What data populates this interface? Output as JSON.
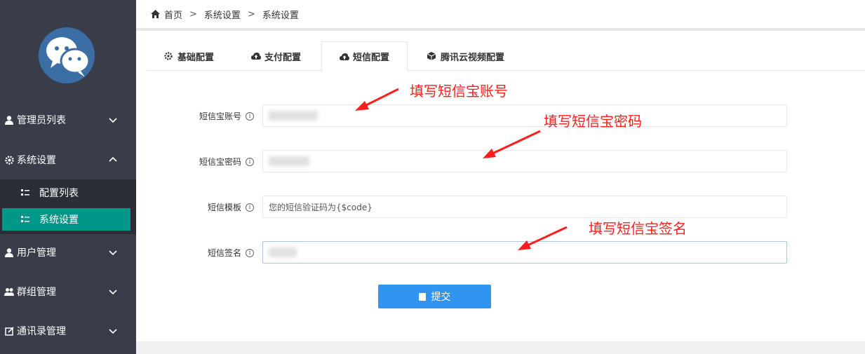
{
  "breadcrumb": {
    "items": [
      "首页",
      "系统设置",
      "系统设置"
    ],
    "separator": ">"
  },
  "sidebar": {
    "menu": [
      {
        "label": "管理员列表",
        "icon": "user-icon"
      },
      {
        "label": "系统设置",
        "icon": "gear-icon"
      },
      {
        "label": "用户管理",
        "icon": "user-icon"
      },
      {
        "label": "群组管理",
        "icon": "group-icon"
      },
      {
        "label": "通讯录管理",
        "icon": "edit-icon"
      }
    ],
    "submenu": [
      {
        "label": "配置列表",
        "icon": "list-icon"
      },
      {
        "label": "系统设置",
        "icon": "list-icon"
      }
    ],
    "active_color": "#009688"
  },
  "tabs": [
    {
      "label": "基础配置",
      "icon": "gear-icon"
    },
    {
      "label": "支付配置",
      "icon": "cloud-upload-icon"
    },
    {
      "label": "短信配置",
      "icon": "cloud-upload-icon"
    },
    {
      "label": "腾讯云视频配置",
      "icon": "cube-icon"
    }
  ],
  "form": {
    "account_label": "短信宝账号",
    "password_label": "短信宝密码",
    "template_label": "短信模板",
    "template_value": "您的短信验证码为{$code}",
    "signature_label": "短信签名",
    "info_glyph": "i",
    "submit_label": "提交"
  },
  "annotations": {
    "account": "填写短信宝账号",
    "password": "填写短信宝密码",
    "signature": "填写短信宝签名"
  },
  "colors": {
    "sidebar": "#393d49",
    "primary": "#3095f0",
    "annotation": "#ff1d1d"
  }
}
